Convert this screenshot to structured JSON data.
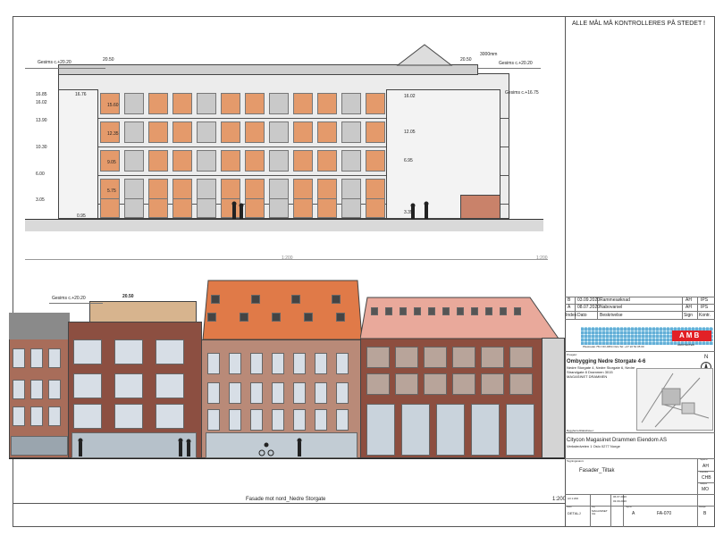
{
  "notice": "ALLE MÅL MÅ KONTROLLERES PÅ STEDET !",
  "section": {
    "gesims_left": "Gesims c.+20.20",
    "width_label": "20.50",
    "width_label_right": "20.50",
    "dim_3000": "3000mm",
    "gesims_right": "Gesims c.+20.20",
    "gesims_right2": "Gesims c.+16.75",
    "levels_left": [
      "16.85",
      "16.02",
      "13.90",
      "10.30",
      "6.00",
      "3.05"
    ],
    "levels_mid": [
      "16.76",
      "15.60",
      "12.35",
      "9.05",
      "5.75",
      "0.95"
    ],
    "levels_right": [
      "16.02",
      "12.05",
      "6.95",
      "3.35"
    ],
    "scale_left": "1:200",
    "scale_right": "1:200"
  },
  "facade": {
    "gesims": "Gesims c.+20.20",
    "width_label": "20.50",
    "caption": "Fasade mot nord_Nedre Storgate",
    "scale": "1:200"
  },
  "revisions": [
    {
      "index": "B",
      "date": "03.09.2020",
      "desc": "Rammesøknad",
      "sign": "AH",
      "kontr": "IPS"
    },
    {
      "index": "A",
      "date": "08.07.2020",
      "desc": "Nabovarsel",
      "sign": "AH",
      "kontr": "IPS"
    }
  ],
  "rev_headers": {
    "index": "Index",
    "date": "Dato",
    "desc": "Beskrivelse",
    "sign": "Sign",
    "kontr": "Kontr."
  },
  "firm": {
    "logo": "AMB",
    "subtitle": "ARKITEKTER",
    "address": "Pilestredet 75C NO-0354 Oslo  Tel: +47 22 54 05 00"
  },
  "project": {
    "label": "Prosjekt:",
    "name": "Ombygging Nedre Storgate 4-6",
    "line1": "Nedre Storgate 4, Nedre Storgate 6, Nedre",
    "line2": "Strandgate 8 Drammen 3015",
    "line3": "MAGASINET DRAMMEN",
    "north": "N"
  },
  "owner": {
    "label": "Byggherre/tiltakshaver:",
    "name": "Citycon Magasinet Drammen Eiendom AS",
    "line1": "Verkstedveien 1 Oslo 0277 Norge"
  },
  "drawing": {
    "label": "Tegningsnavn:",
    "title": "Fasader_Tiltak",
    "signs": [
      "AH",
      "CHB",
      "MO"
    ],
    "sign_labels": [
      "Tegnet av",
      "Kontrollert",
      "Godkjent"
    ],
    "dates": [
      "06.07.2020",
      "03.09.2020"
    ],
    "scale_label": "A3 1:200",
    "code_labels": [
      "Status",
      "Fag",
      "Tegn.nr.",
      "Revisjon"
    ],
    "status": "DETALJ",
    "fag": "MAGASINET CH",
    "size": "A",
    "number": "FA-070",
    "rev": "B"
  }
}
